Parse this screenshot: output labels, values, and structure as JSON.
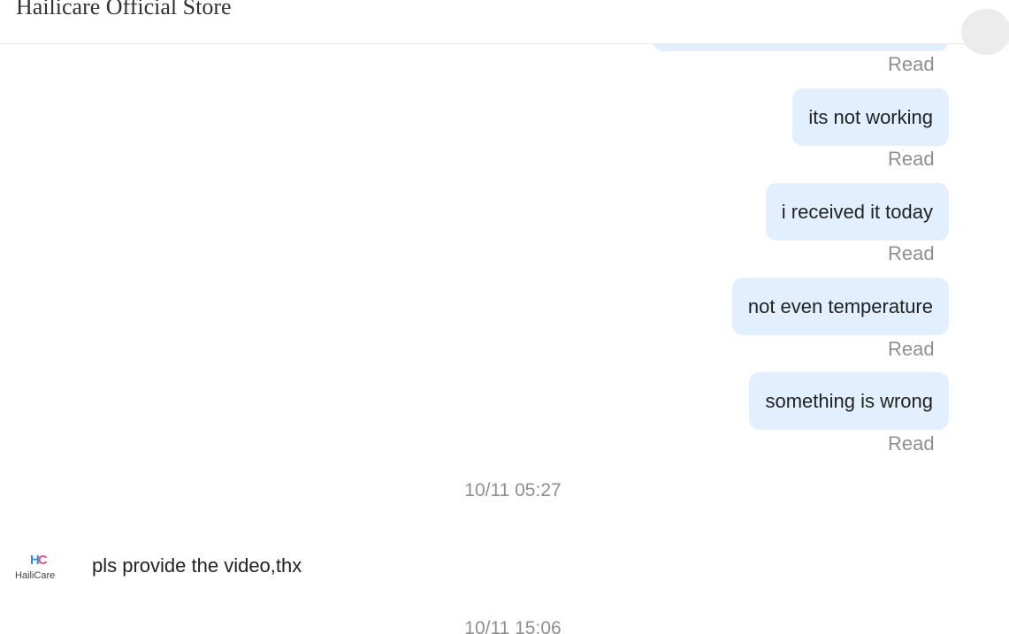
{
  "header": {
    "title": "Hailicare Official Store"
  },
  "messages_out": [
    {
      "text": "its not working",
      "status": "Read"
    },
    {
      "text": "i received it today",
      "status": "Read"
    },
    {
      "text": "not even temperature",
      "status": "Read"
    },
    {
      "text": "something is wrong",
      "status": "Read"
    }
  ],
  "top_status": "Read",
  "timestamps": [
    "10/11 05:27",
    "10/11 15:06"
  ],
  "incoming": {
    "logo_mark": "HC",
    "logo_text": "HailiCare",
    "text": "pls provide the video,thx"
  },
  "colors": {
    "bubble": "#e2efff",
    "meta_text": "#8f8f8f",
    "logo_h": "#3a8fd8",
    "logo_c": "#e4567b"
  }
}
